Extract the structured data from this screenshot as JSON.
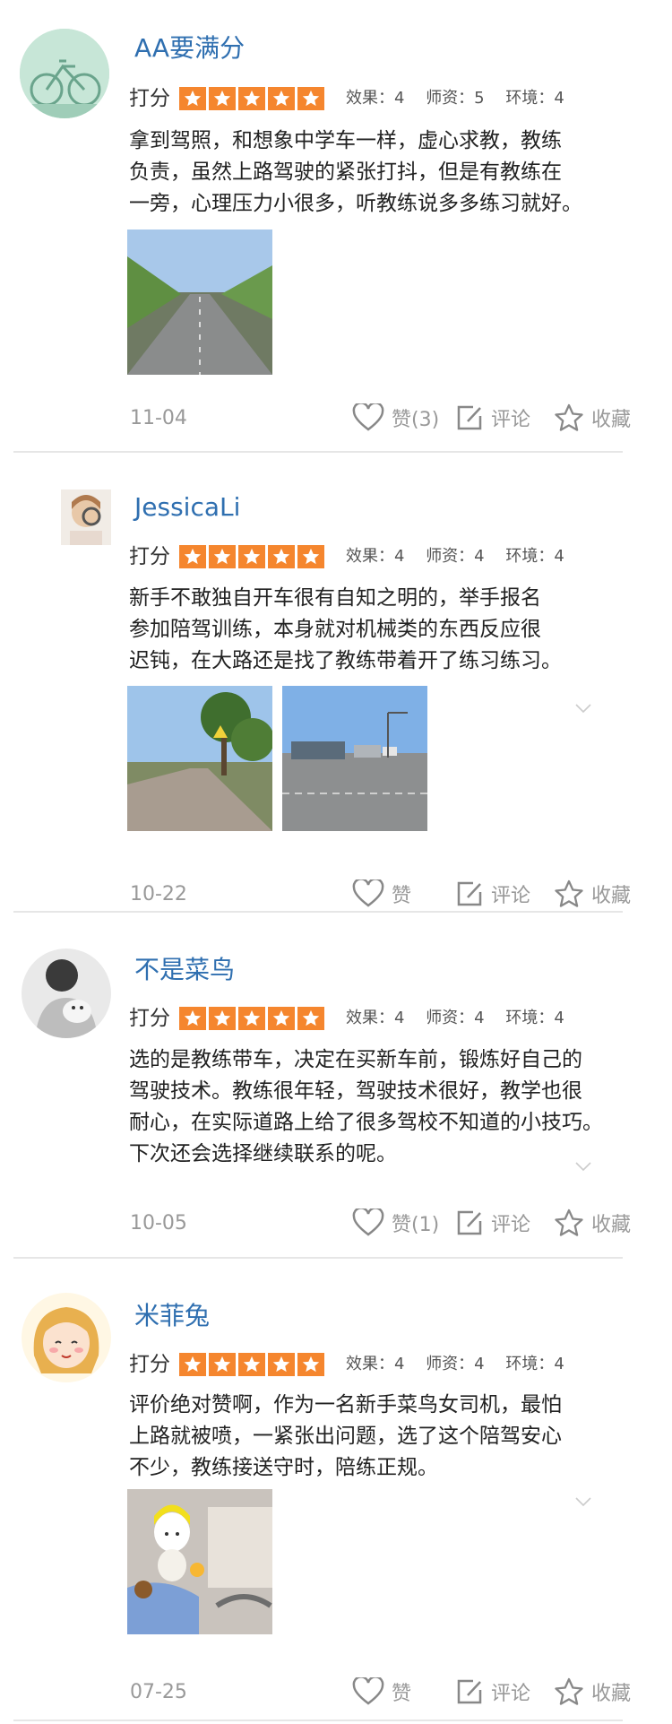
{
  "labels": {
    "rating": "打分",
    "comment": "评论",
    "favorite": "收藏"
  },
  "colors": {
    "star_bg": "#f5862e",
    "name": "#2f6fb0",
    "muted": "#999999"
  },
  "reviews": [
    {
      "username": "AA要满分",
      "scores": [
        "效果：4",
        "师资：5",
        "环境：4"
      ],
      "stars": 5,
      "lines": [
        "拿到驾照，和想象中学车一样，虚心求教，教练",
        "负责，虽然上路驾驶的紧张打抖，但是有教练在",
        "一旁，心理压力小很多，听教练说多多练习就好。"
      ],
      "date": "11-04",
      "like": "赞(3)"
    },
    {
      "username": "JessicaLi",
      "scores": [
        "效果：4",
        "师资：4",
        "环境：4"
      ],
      "stars": 5,
      "lines": [
        "新手不敢独自开车很有自知之明的，举手报名",
        "参加陪驾训练，本身就对机械类的东西反应很",
        "迟钝，在大路还是找了教练带着开了练习练习。"
      ],
      "date": "10-22",
      "like": "赞"
    },
    {
      "username": "不是菜鸟",
      "scores": [
        "效果：4",
        "师资：4",
        "环境：4"
      ],
      "stars": 5,
      "lines": [
        "选的是教练带车，决定在买新车前，锻炼好自己的",
        "驾驶技术。教练很年轻，驾驶技术很好，教学也很",
        "耐心，在实际道路上给了很多驾校不知道的小技巧。",
        "下次还会选择继续联系的呢。"
      ],
      "date": "10-05",
      "like": "赞(1)"
    },
    {
      "username": "米菲兔",
      "scores": [
        "效果：4",
        "师资：4",
        "环境：4"
      ],
      "stars": 5,
      "lines": [
        "评价绝对赞啊，作为一名新手菜鸟女司机，最怕",
        "上路就被喷，一紧张出问题，选了这个陪驾安心",
        "不少，教练接送守时，陪练正规。"
      ],
      "date": "07-25",
      "like": "赞"
    }
  ]
}
